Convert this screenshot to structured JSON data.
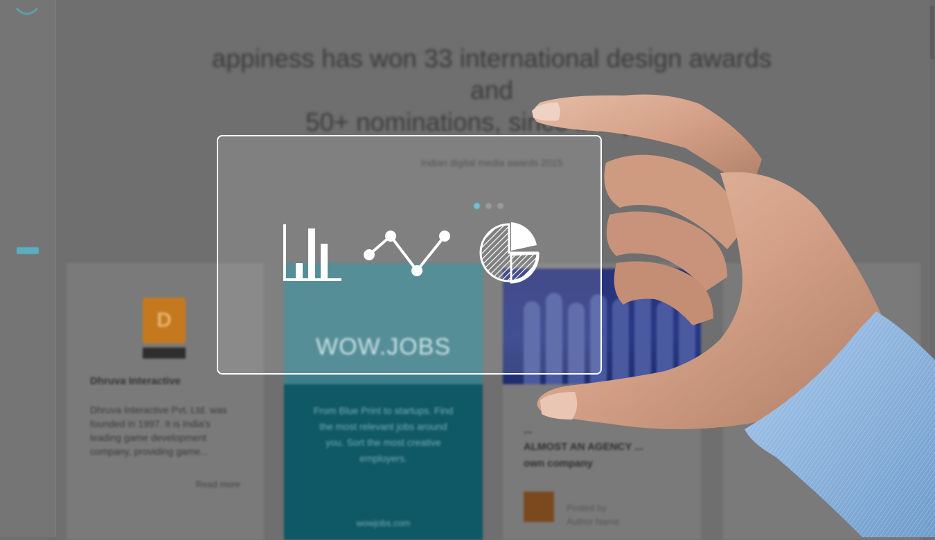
{
  "hero": {
    "headline_line1": "appiness has won 33 international design awards and",
    "headline_line2": "50+ nominations, since inception",
    "sub_line1": "",
    "sub_line2": "",
    "sub_line3": "Indian digital media awards 2015"
  },
  "cards": {
    "c1": {
      "logo_glyph": "D",
      "title": "Dhruva Interactive",
      "text": "Dhruva Interactive Pvt. Ltd. was founded in 1997. It is India's leading game development company, providing game...",
      "more": "Read more"
    },
    "c2": {
      "logo": "WOW.JOBS",
      "text": "From Blue Print to startups. Find the most relevant jobs around you. Sort the most creative employers.",
      "foot": "wowjobs.com"
    },
    "c3": {
      "heading_line1": "...",
      "heading_line2": "ALMOST AN AGENCY ...",
      "heading_line3": "own company",
      "author_line1": "Posted by",
      "author_line2": "Author Name"
    }
  },
  "icons": [
    "bar-chart-icon",
    "line-chart-icon",
    "pie-chart-icon"
  ],
  "colors": {
    "accent": "#57b7cc",
    "panel_border": "#ffffff",
    "skin": "#d9a98f",
    "shirt": "#8db4dc"
  }
}
